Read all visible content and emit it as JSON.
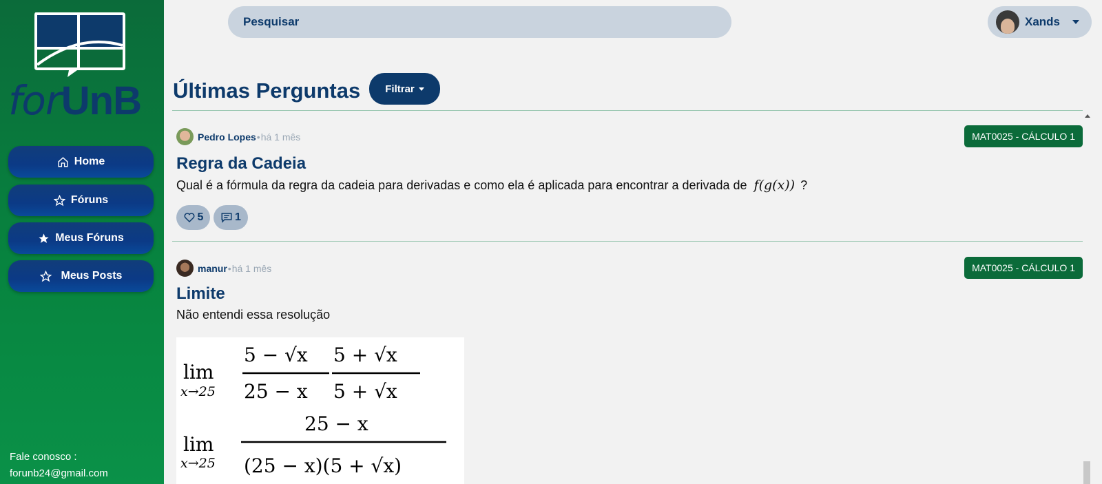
{
  "sidebar": {
    "brand_for": "for",
    "brand_unb": "UnB",
    "nav": [
      {
        "label": "Home",
        "icon": "home-icon"
      },
      {
        "label": "Fóruns",
        "icon": "star-outline-icon"
      },
      {
        "label": "Meus Fóruns",
        "icon": "star-filled-icon"
      },
      {
        "label": "Meus Posts",
        "icon": "star-outline-icon"
      }
    ],
    "contact_label": "Fale conosco :",
    "contact_email": "forunb24@gmail.com"
  },
  "header": {
    "search_label": "Pesquisar",
    "user_name": "Xands"
  },
  "main": {
    "title": "Últimas Perguntas",
    "filter_label": "Filtrar",
    "posts": [
      {
        "author": "Pedro Lopes",
        "separator": "•",
        "time": "há 1 mês",
        "tag": "MAT0025 - CÁLCULO 1",
        "title": "Regra da Cadeia",
        "body": "Qual é a fórmula da regra da cadeia para derivadas e como ela é aplicada para encontrar a derivada de",
        "math": "f(g(x))",
        "body_end": "?",
        "likes": "5",
        "comments": "1"
      },
      {
        "author": "manur",
        "separator": "•",
        "time": "há 1 mês",
        "tag": "MAT0025 - CÁLCULO 1",
        "title": "Limite",
        "body": "Não entendi essa resolução"
      }
    ],
    "math_image": {
      "lim": "lim",
      "sub": "x→25",
      "num1": "5 − √x",
      "den1": "25 − x",
      "num2": "5 + √x",
      "den2": "5 + √x",
      "num3": "25 − x",
      "den3": "(25 − x)(5 + √x)"
    }
  },
  "colors": {
    "primary": "#0d3a6b",
    "sidebar_green": "#07843f",
    "tag_green": "#0b6b3a",
    "search_bg": "#c9d3de"
  }
}
